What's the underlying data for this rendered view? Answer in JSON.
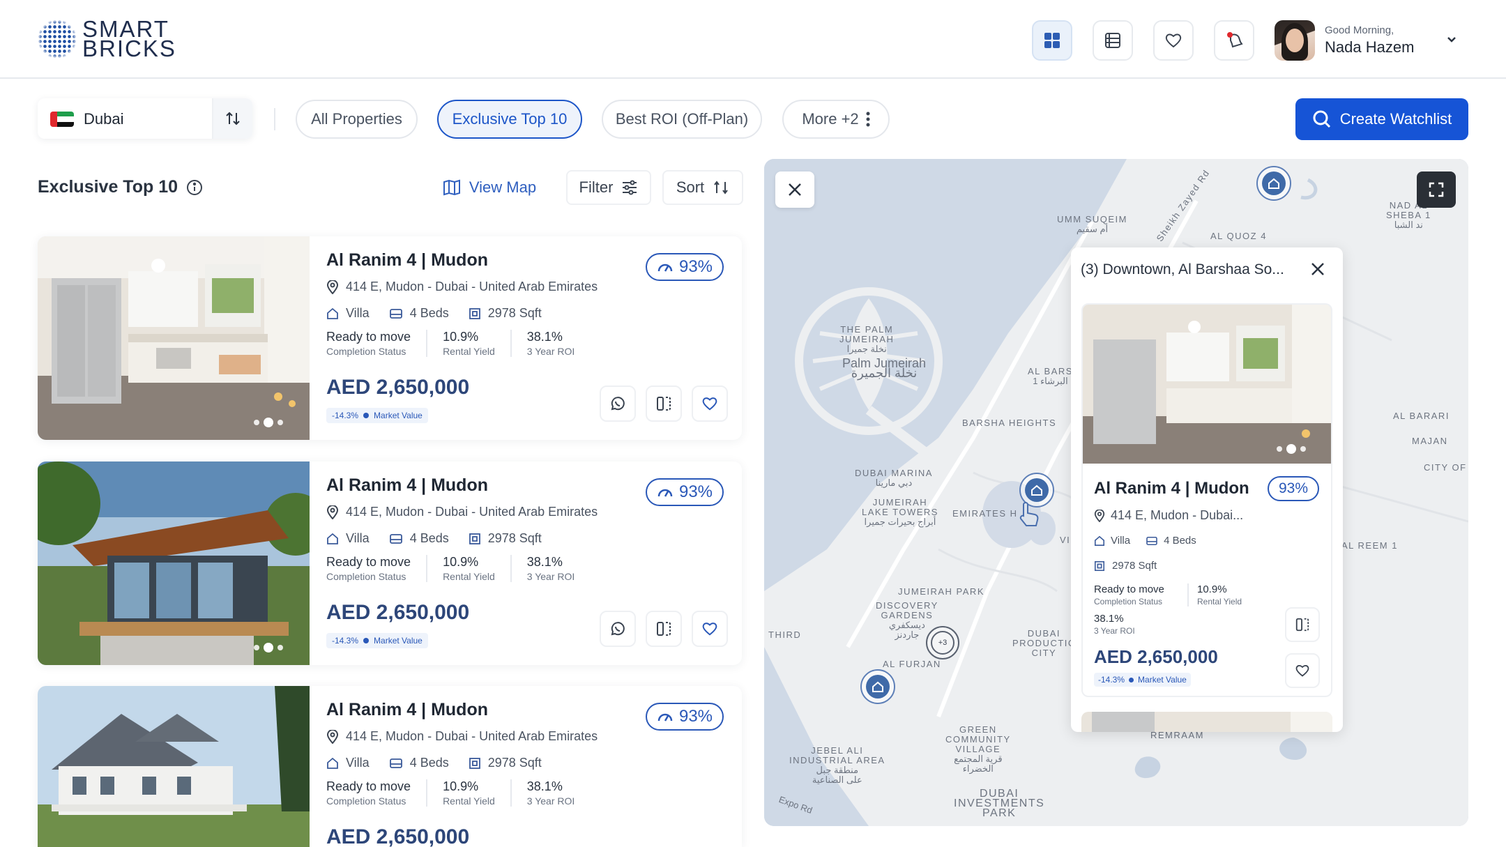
{
  "brand": {
    "line1": "SMART",
    "line2": "BRICKS"
  },
  "user": {
    "greeting": "Good Morning,",
    "name": "Nada Hazem"
  },
  "toolbar": {
    "city": "Dubai",
    "chips": [
      "All Properties",
      "Exclusive Top 10",
      "Best ROI (Off-Plan)",
      "More +2"
    ],
    "active_chip": "Exclusive Top 10",
    "cta": "Create Watchlist"
  },
  "list": {
    "title": "Exclusive Top 10",
    "view_map": "View Map",
    "filter": "Filter",
    "sort": "Sort",
    "cards": [
      {
        "title": "Al Ranim 4 | Mudon",
        "address": "414 E, Mudon - Dubai - United Arab Emirates",
        "type": "Villa",
        "beds": "4 Beds",
        "area": "2978 Sqft",
        "status": "Ready to move",
        "status_label": "Completion Status",
        "yield": "10.9%",
        "yield_label": "Rental Yield",
        "roi": "38.1%",
        "roi_label": "3 Year ROI",
        "price": "AED 2,650,000",
        "mv_change": "-14.3%",
        "mv_label": "Market Value",
        "score": "93%"
      },
      {
        "title": "Al Ranim 4 | Mudon",
        "address": "414 E, Mudon - Dubai - United Arab Emirates",
        "type": "Villa",
        "beds": "4 Beds",
        "area": "2978 Sqft",
        "status": "Ready to move",
        "status_label": "Completion Status",
        "yield": "10.9%",
        "yield_label": "Rental Yield",
        "roi": "38.1%",
        "roi_label": "3 Year ROI",
        "price": "AED 2,650,000",
        "mv_change": "-14.3%",
        "mv_label": "Market Value",
        "score": "93%"
      },
      {
        "title": "Al Ranim 4 | Mudon",
        "address": "414 E, Mudon - Dubai - United Arab Emirates",
        "type": "Villa",
        "beds": "4 Beds",
        "area": "2978 Sqft",
        "status": "Ready to move",
        "status_label": "Completion Status",
        "yield": "10.9%",
        "yield_label": "Rental Yield",
        "roi": "38.1%",
        "roi_label": "3 Year ROI",
        "price": "AED 2,650,000",
        "mv_change": "-14.3%",
        "mv_label": "Market Value",
        "score": "93%"
      }
    ]
  },
  "map": {
    "labels": {
      "umm_suqeim": "UMM SUQEIM",
      "umm_suqeim_ar": "أم سقيم",
      "sheikh_zayed": "Sheikh Zayed Rd",
      "al_quoz": "AL QUOZ 4",
      "nad_sheba": "NAD AL",
      "nad_sheba2": "SHEBA 1",
      "nad_sheba_ar": "ند الشبا",
      "palm1": "THE PALM",
      "palm2": "JUMEIRAH",
      "palm_ar": "نخلة جميرا",
      "palm_big": "Palm Jumeirah",
      "palm_big_ar": "نخلة الجميرة",
      "al_barsha": "AL BARS",
      "al_barsha2": "1 البرشاء",
      "barsha_heights": "BARSHA HEIGHTS",
      "al_barari": "AL BARARI",
      "majan": "MAJAN",
      "city_of": "CITY OF",
      "dubai_marina": "DUBAI MARINA",
      "dubai_marina_ar": "دبي مارينا",
      "jlt1": "JUMEIRAH",
      "jlt2": "LAKE TOWERS",
      "jlt_ar": "أبراج بحيرات جميرا",
      "emirates_hills": "EMIRATES H",
      "al_reem": "AL REEM 1",
      "jumeirah_park": "JUMEIRAH PARK",
      "discovery1": "DISCOVERY",
      "discovery2": "GARDENS",
      "discovery_ar": "ديسكفري",
      "discovery_ar2": "جاردنز",
      "third": "THIRD",
      "dpc1": "DUBAI",
      "dpc2": "PRODUCTIC",
      "dpc3": "CITY",
      "al_furjan": "AL FURJAN",
      "green1": "GREEN",
      "green2": "COMMUNITY",
      "green3": "VILLAGE",
      "green_ar": "قرية المجتمع",
      "green_ar2": "الخضراء",
      "remraam": "REMRAAM",
      "jebel1": "JEBEL ALI",
      "jebel2": "INDUSTRIAL AREA",
      "jebel_ar": "منطقة جبل",
      "jebel_ar2": "على الصناعية",
      "dip1": "DUBAI",
      "dip2": "INVESTMENTS",
      "dip3": "PARK",
      "expo": "Expo Rd",
      "vi": "VI"
    },
    "cluster_count": "+3",
    "popup": {
      "heading": "(3) Downtown, Al Barshaa So...",
      "title": "Al Ranim 4 | Mudon",
      "score": "93%",
      "address": "414 E, Mudon - Dubai...",
      "type": "Villa",
      "beds": "4 Beds",
      "area": "2978 Sqft",
      "status": "Ready to move",
      "status_label": "Completion Status",
      "yield": "10.9%",
      "yield_label": "Rental Yield",
      "roi": "38.1%",
      "roi_label": "3 Year ROI",
      "price": "AED 2,650,000",
      "mv_change": "-14.3%",
      "mv_label": "Market Value"
    }
  },
  "colors": {
    "primary": "#1654d6",
    "accent": "#2a58b8",
    "price": "#2d4679",
    "map_bg": "#dce3ec",
    "map_water": "#c7d3e2"
  }
}
